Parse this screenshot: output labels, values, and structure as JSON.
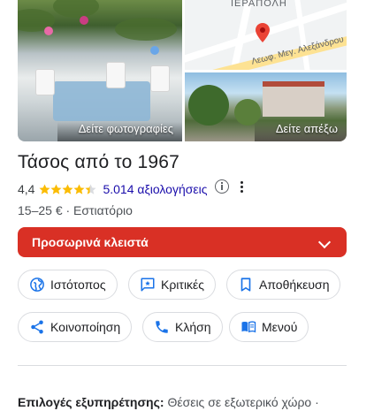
{
  "photos": {
    "main_label": "Δείτε φωτογραφίες",
    "street_label": "Δείτε απέξω",
    "map_labels": {
      "area": "ΙΕΡΑΠΟΛΗ",
      "street": "Λεωφ. Μεγ. Αλεξάνδρου"
    }
  },
  "place": {
    "name": "Τάσος από το 1967",
    "rating": "4,4",
    "rating_value": 4.4,
    "reviews": "5.014 αξιολογήσεις",
    "price_category": "15–25 € · Εστιατόριο"
  },
  "status": {
    "label": "Προσωρινά κλειστά"
  },
  "actions": {
    "website": "Ιστότοπος",
    "reviews": "Κριτικές",
    "save": "Αποθήκευση",
    "share": "Κοινοποίηση",
    "call": "Κλήση",
    "menu": "Μενού"
  },
  "services": {
    "label": "Επιλογές εξυπηρέτησης:",
    "value": "Θέσεις σε εξωτερικό χώρο ·"
  },
  "colors": {
    "closed_bar": "#d93025",
    "link": "#1a0dab",
    "chip_icon": "#1a73e8",
    "star": "#fbbc04",
    "map_pin": "#ea4335"
  }
}
